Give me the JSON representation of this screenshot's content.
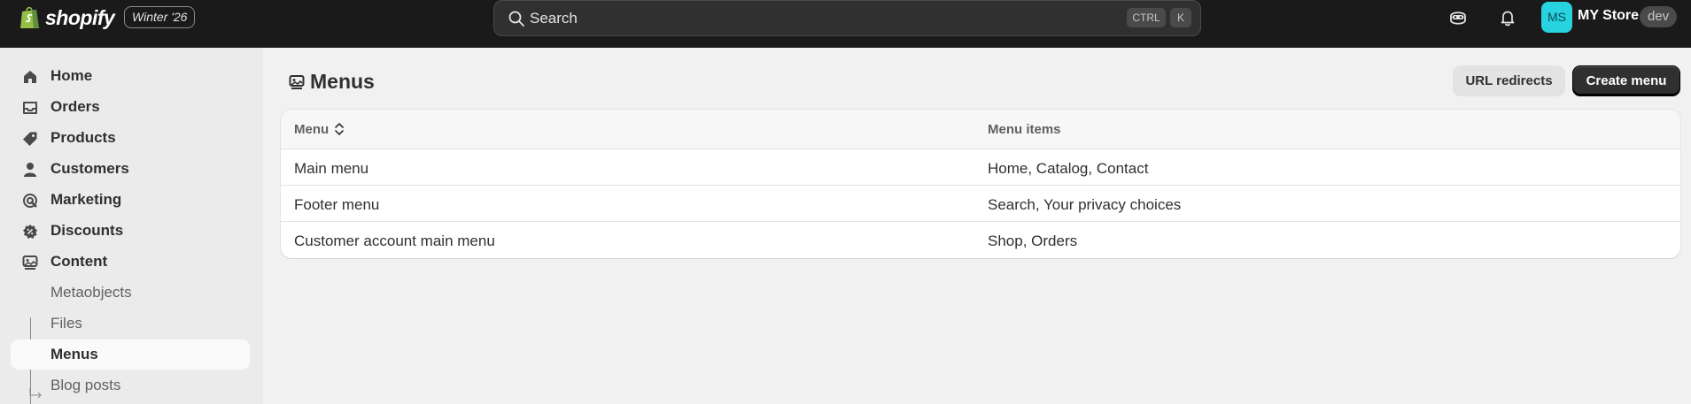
{
  "header": {
    "logo_text": "shopify",
    "edition_badge": "Winter '26",
    "search": {
      "label": "Search",
      "shortcut_ctrl": "CTRL",
      "shortcut_key": "K"
    },
    "store": {
      "initials": "MS",
      "name": "MY Store",
      "badge": "dev"
    }
  },
  "sidebar": {
    "items": [
      {
        "label": "Home",
        "icon": "home-icon"
      },
      {
        "label": "Orders",
        "icon": "inbox-icon"
      },
      {
        "label": "Products",
        "icon": "tag-icon"
      },
      {
        "label": "Customers",
        "icon": "person-icon"
      },
      {
        "label": "Marketing",
        "icon": "target-icon"
      },
      {
        "label": "Discounts",
        "icon": "discount-icon"
      },
      {
        "label": "Content",
        "icon": "content-icon"
      }
    ],
    "sub_items": [
      {
        "label": "Metaobjects"
      },
      {
        "label": "Files"
      },
      {
        "label": "Menus",
        "active": true
      },
      {
        "label": "Blog posts"
      }
    ]
  },
  "page": {
    "title": "Menus",
    "secondary_action": "URL redirects",
    "primary_action": "Create menu"
  },
  "table": {
    "columns": [
      "Menu",
      "Menu items"
    ],
    "rows": [
      {
        "menu": "Main menu",
        "items": "Home, Catalog, Contact"
      },
      {
        "menu": "Footer menu",
        "items": "Search, Your privacy choices"
      },
      {
        "menu": "Customer account main menu",
        "items": "Shop, Orders"
      }
    ]
  },
  "colors": {
    "topbar": "#1a1a1a",
    "avatar": "#26d3de",
    "primary_button": "#303030",
    "sidebar_bg": "#ebebeb"
  }
}
